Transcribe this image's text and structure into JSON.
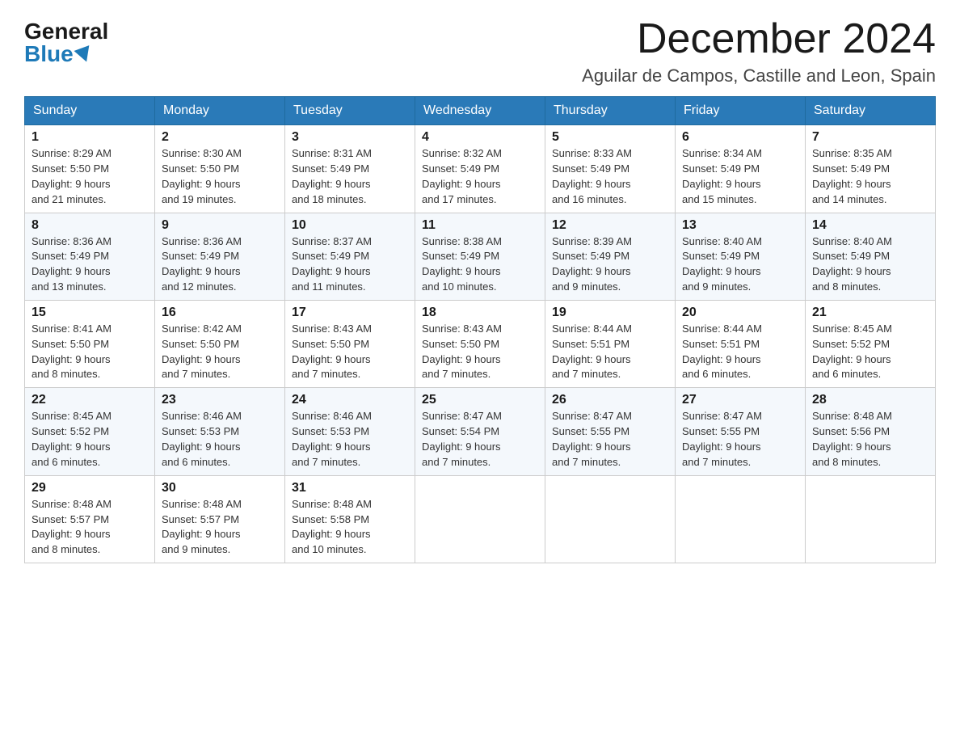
{
  "header": {
    "logo_general": "General",
    "logo_blue": "Blue",
    "month_year": "December 2024",
    "location": "Aguilar de Campos, Castille and Leon, Spain"
  },
  "weekdays": [
    "Sunday",
    "Monday",
    "Tuesday",
    "Wednesday",
    "Thursday",
    "Friday",
    "Saturday"
  ],
  "weeks": [
    [
      {
        "day": "1",
        "sunrise": "8:29 AM",
        "sunset": "5:50 PM",
        "daylight": "9 hours and 21 minutes."
      },
      {
        "day": "2",
        "sunrise": "8:30 AM",
        "sunset": "5:50 PM",
        "daylight": "9 hours and 19 minutes."
      },
      {
        "day": "3",
        "sunrise": "8:31 AM",
        "sunset": "5:49 PM",
        "daylight": "9 hours and 18 minutes."
      },
      {
        "day": "4",
        "sunrise": "8:32 AM",
        "sunset": "5:49 PM",
        "daylight": "9 hours and 17 minutes."
      },
      {
        "day": "5",
        "sunrise": "8:33 AM",
        "sunset": "5:49 PM",
        "daylight": "9 hours and 16 minutes."
      },
      {
        "day": "6",
        "sunrise": "8:34 AM",
        "sunset": "5:49 PM",
        "daylight": "9 hours and 15 minutes."
      },
      {
        "day": "7",
        "sunrise": "8:35 AM",
        "sunset": "5:49 PM",
        "daylight": "9 hours and 14 minutes."
      }
    ],
    [
      {
        "day": "8",
        "sunrise": "8:36 AM",
        "sunset": "5:49 PM",
        "daylight": "9 hours and 13 minutes."
      },
      {
        "day": "9",
        "sunrise": "8:36 AM",
        "sunset": "5:49 PM",
        "daylight": "9 hours and 12 minutes."
      },
      {
        "day": "10",
        "sunrise": "8:37 AM",
        "sunset": "5:49 PM",
        "daylight": "9 hours and 11 minutes."
      },
      {
        "day": "11",
        "sunrise": "8:38 AM",
        "sunset": "5:49 PM",
        "daylight": "9 hours and 10 minutes."
      },
      {
        "day": "12",
        "sunrise": "8:39 AM",
        "sunset": "5:49 PM",
        "daylight": "9 hours and 9 minutes."
      },
      {
        "day": "13",
        "sunrise": "8:40 AM",
        "sunset": "5:49 PM",
        "daylight": "9 hours and 9 minutes."
      },
      {
        "day": "14",
        "sunrise": "8:40 AM",
        "sunset": "5:49 PM",
        "daylight": "9 hours and 8 minutes."
      }
    ],
    [
      {
        "day": "15",
        "sunrise": "8:41 AM",
        "sunset": "5:50 PM",
        "daylight": "9 hours and 8 minutes."
      },
      {
        "day": "16",
        "sunrise": "8:42 AM",
        "sunset": "5:50 PM",
        "daylight": "9 hours and 7 minutes."
      },
      {
        "day": "17",
        "sunrise": "8:43 AM",
        "sunset": "5:50 PM",
        "daylight": "9 hours and 7 minutes."
      },
      {
        "day": "18",
        "sunrise": "8:43 AM",
        "sunset": "5:50 PM",
        "daylight": "9 hours and 7 minutes."
      },
      {
        "day": "19",
        "sunrise": "8:44 AM",
        "sunset": "5:51 PM",
        "daylight": "9 hours and 7 minutes."
      },
      {
        "day": "20",
        "sunrise": "8:44 AM",
        "sunset": "5:51 PM",
        "daylight": "9 hours and 6 minutes."
      },
      {
        "day": "21",
        "sunrise": "8:45 AM",
        "sunset": "5:52 PM",
        "daylight": "9 hours and 6 minutes."
      }
    ],
    [
      {
        "day": "22",
        "sunrise": "8:45 AM",
        "sunset": "5:52 PM",
        "daylight": "9 hours and 6 minutes."
      },
      {
        "day": "23",
        "sunrise": "8:46 AM",
        "sunset": "5:53 PM",
        "daylight": "9 hours and 6 minutes."
      },
      {
        "day": "24",
        "sunrise": "8:46 AM",
        "sunset": "5:53 PM",
        "daylight": "9 hours and 7 minutes."
      },
      {
        "day": "25",
        "sunrise": "8:47 AM",
        "sunset": "5:54 PM",
        "daylight": "9 hours and 7 minutes."
      },
      {
        "day": "26",
        "sunrise": "8:47 AM",
        "sunset": "5:55 PM",
        "daylight": "9 hours and 7 minutes."
      },
      {
        "day": "27",
        "sunrise": "8:47 AM",
        "sunset": "5:55 PM",
        "daylight": "9 hours and 7 minutes."
      },
      {
        "day": "28",
        "sunrise": "8:48 AM",
        "sunset": "5:56 PM",
        "daylight": "9 hours and 8 minutes."
      }
    ],
    [
      {
        "day": "29",
        "sunrise": "8:48 AM",
        "sunset": "5:57 PM",
        "daylight": "9 hours and 8 minutes."
      },
      {
        "day": "30",
        "sunrise": "8:48 AM",
        "sunset": "5:57 PM",
        "daylight": "9 hours and 9 minutes."
      },
      {
        "day": "31",
        "sunrise": "8:48 AM",
        "sunset": "5:58 PM",
        "daylight": "9 hours and 10 minutes."
      },
      null,
      null,
      null,
      null
    ]
  ]
}
